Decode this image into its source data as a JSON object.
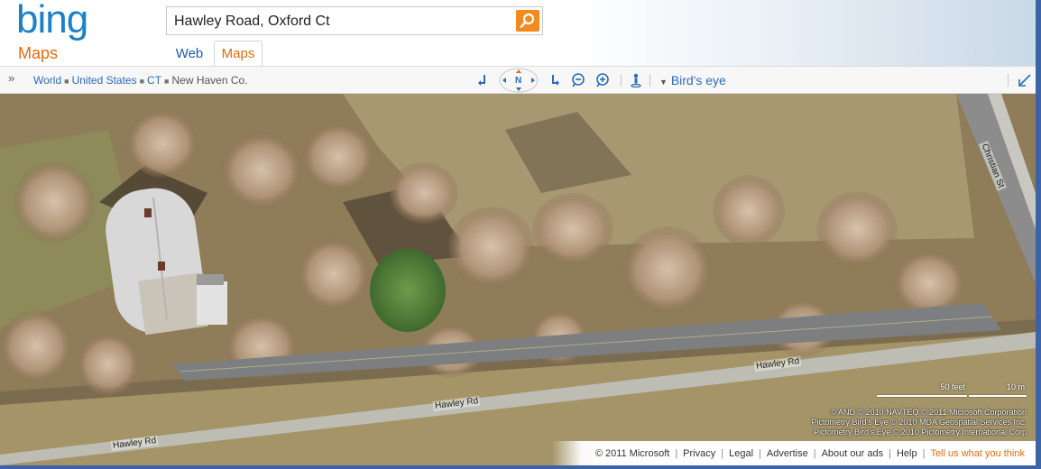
{
  "header": {
    "logo": "bing",
    "vertical_title": "Maps",
    "search_value": "Hawley Road, Oxford Ct",
    "tabs": [
      {
        "label": "Web",
        "active": false
      },
      {
        "label": "Maps",
        "active": true
      }
    ]
  },
  "toolbar": {
    "expand_icon": "double-chevron-right-icon",
    "breadcrumb": [
      "World",
      "United States",
      "CT",
      "New Haven Co."
    ],
    "compass_label": "N",
    "view_mode": "Bird's eye"
  },
  "map": {
    "road_labels": {
      "christian": "Christian St",
      "hawley_1": "Hawley Rd",
      "hawley_2": "Hawley Rd",
      "hawley_3": "Hawley Rd"
    },
    "scale": {
      "feet": "50 feet",
      "meters": "10 m"
    },
    "copyright": [
      "© AND   © 2010 NAVTEQ   © 2011 Microsoft Corporation",
      "Pictometry Bird's Eye © 2010 MDA Geospatial Services Inc.",
      "Pictometry Bird's Eye © 2010 Pictometry International Corp"
    ]
  },
  "footer": {
    "copyright": "© 2011 Microsoft",
    "links": [
      "Privacy",
      "Legal",
      "Advertise",
      "About our ads",
      "Help"
    ],
    "feedback": "Tell us what you think"
  },
  "colors": {
    "brand_blue": "#1d80c9",
    "accent_orange": "#e06b0c",
    "link_blue": "#2a6bb8"
  }
}
